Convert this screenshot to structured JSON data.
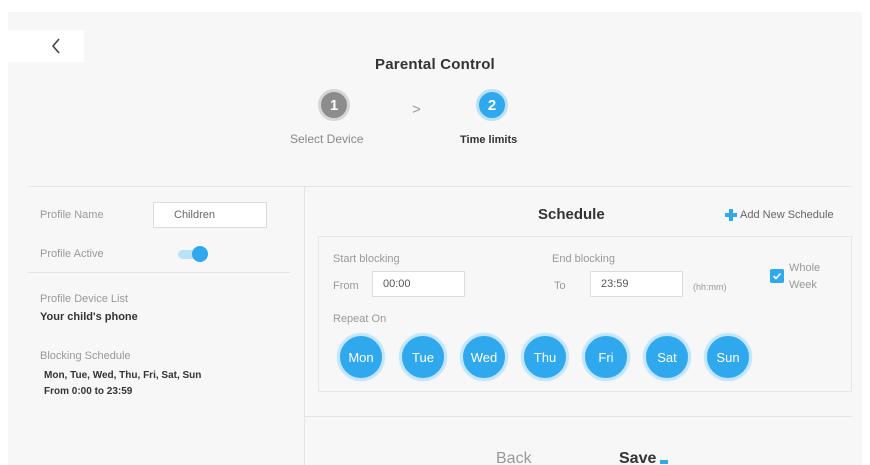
{
  "header": {
    "title": "Parental Control",
    "steps": [
      {
        "number": "1",
        "label": "Select Device"
      },
      {
        "number": "2",
        "label": "Time limits"
      }
    ],
    "step_separator": ">"
  },
  "profile": {
    "name_label": "Profile Name",
    "name_value": "Children",
    "active_label": "Profile Active",
    "active": true,
    "device_list_label": "Profile Device List",
    "device_list_value": "Your child's phone",
    "blocking_schedule_label": "Blocking Schedule",
    "blocking_days": "Mon, Tue, Wed, Thu, Fri, Sat, Sun",
    "blocking_time": "From 0:00 to 23:59"
  },
  "schedule": {
    "title": "Schedule",
    "add_label": "Add New Schedule",
    "start_label": "Start blocking",
    "from_label": "From",
    "from_value": "00:00",
    "end_label": "End blocking",
    "to_label": "To",
    "to_value": "23:59",
    "format_hint": "(hh:mm)",
    "whole_week_label_1": "Whole",
    "whole_week_label_2": "Week",
    "whole_week_checked": true,
    "repeat_label": "Repeat On",
    "days": [
      "Mon",
      "Tue",
      "Wed",
      "Thu",
      "Fri",
      "Sat",
      "Sun"
    ]
  },
  "footer": {
    "back_label": "Back",
    "save_label": "Save"
  },
  "colors": {
    "accent": "#2fa8ee",
    "accent_light": "#b9e1f8",
    "step_inactive": "#8c8c8c"
  },
  "icons": {
    "back": "chevron-left-icon",
    "add": "plus-icon",
    "check": "check-icon"
  }
}
